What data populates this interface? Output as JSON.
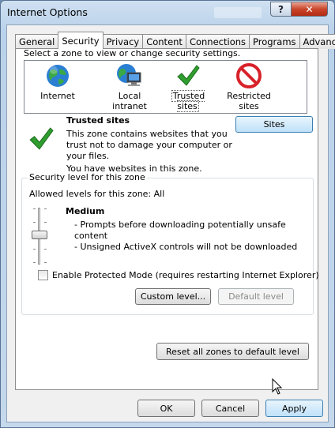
{
  "window": {
    "title": "Internet Options",
    "help_glyph": "?",
    "close_glyph": "✕",
    "close_color": "#c9462c"
  },
  "tabs": [
    {
      "label": "General",
      "active": false
    },
    {
      "label": "Security",
      "active": true
    },
    {
      "label": "Privacy",
      "active": false
    },
    {
      "label": "Content",
      "active": false
    },
    {
      "label": "Connections",
      "active": false
    },
    {
      "label": "Programs",
      "active": false
    },
    {
      "label": "Advanced",
      "active": false
    }
  ],
  "security": {
    "zone_prompt": "Select a zone to view or change security settings.",
    "zones": [
      {
        "label": "Internet",
        "icon": "globe-icon"
      },
      {
        "label": "Local intranet",
        "icon": "intranet-icon"
      },
      {
        "label": "Trusted sites",
        "icon": "checkmark-icon",
        "selected": true
      },
      {
        "label": "Restricted sites",
        "icon": "restricted-icon"
      }
    ],
    "selected_zone": {
      "name": "Trusted sites",
      "description": [
        "This zone contains websites that you",
        "trust not to damage your computer or",
        "your files."
      ],
      "status": "You have websites in this zone.",
      "sites_button": "Sites"
    },
    "level_group": {
      "legend": "Security level for this zone",
      "allowed": "Allowed levels for this zone: All",
      "level_name": "Medium",
      "bullets": [
        "- Prompts before downloading potentially unsafe",
        "content",
        "- Unsigned ActiveX controls will not be downloaded"
      ],
      "protected_mode_label": "Enable Protected Mode (requires restarting Internet Explorer)",
      "protected_mode_checked": false,
      "custom_level_button": "Custom level...",
      "default_level_button": "Default level"
    },
    "reset_button": "Reset all zones to default level"
  },
  "footer": {
    "ok": "OK",
    "cancel": "Cancel",
    "apply": "Apply"
  },
  "colors": {
    "accent_blue": "#3c7fb1",
    "check_green": "#2f9e2f",
    "restricted_red": "#d8222a"
  }
}
